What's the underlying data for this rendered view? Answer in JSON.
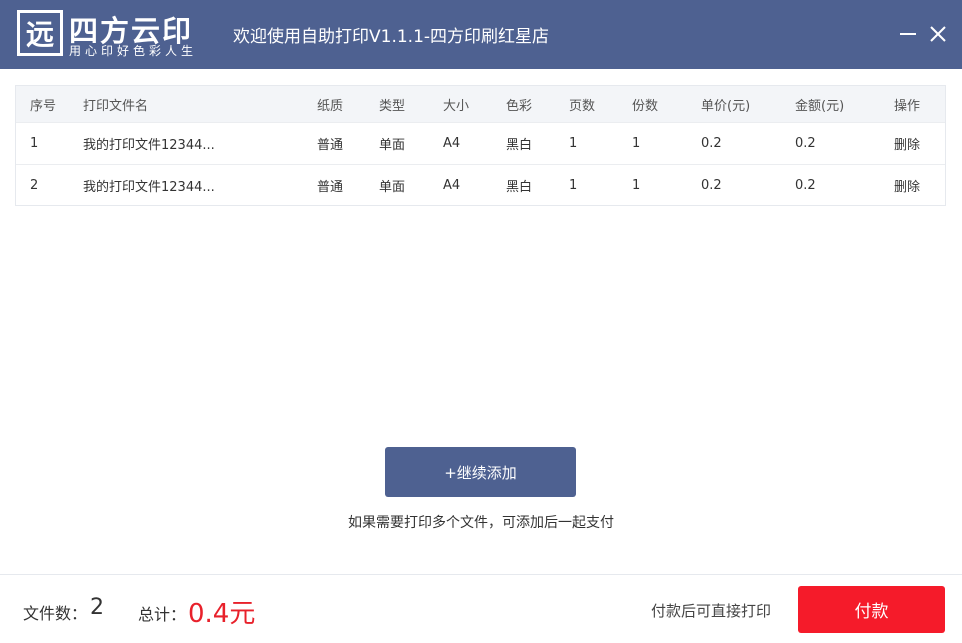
{
  "colors": {
    "header_bg": "#4e6191",
    "accent": "#4e6191",
    "pay_button": "#f51b2a",
    "total_amount": "#e8212b"
  },
  "titlebar": {
    "logo_mark": "远",
    "logo_name": "四方云印",
    "logo_slogan": "用心印好色彩人生",
    "title": "欢迎使用自助打印V1.1.1-四方印刷红星店",
    "minimize_icon": "minimize-icon",
    "close_icon": "close-icon"
  },
  "table": {
    "headers": [
      "序号",
      "打印文件名",
      "纸质",
      "类型",
      "大小",
      "色彩",
      "页数",
      "份数",
      "单价(元)",
      "金额(元)",
      "操作"
    ],
    "rows": [
      {
        "index": "1",
        "filename": "我的打印文件12344...",
        "paper": "普通",
        "type": "单面",
        "size": "A4",
        "color": "黑白",
        "pages": "1",
        "copies": "1",
        "unit_price": "0.2",
        "amount": "0.2",
        "action": "删除"
      },
      {
        "index": "2",
        "filename": "我的打印文件12344...",
        "paper": "普通",
        "type": "单面",
        "size": "A4",
        "color": "黑白",
        "pages": "1",
        "copies": "1",
        "unit_price": "0.2",
        "amount": "0.2",
        "action": "删除"
      }
    ]
  },
  "add_button": "+继续添加",
  "hint": "如果需要打印多个文件，可添加后一起支付",
  "footer": {
    "file_count_label": "文件数：",
    "file_count": "2",
    "total_label": "总计：",
    "total_amount": "0.4元",
    "pay_hint": "付款后可直接打印",
    "pay_button": "付款"
  }
}
